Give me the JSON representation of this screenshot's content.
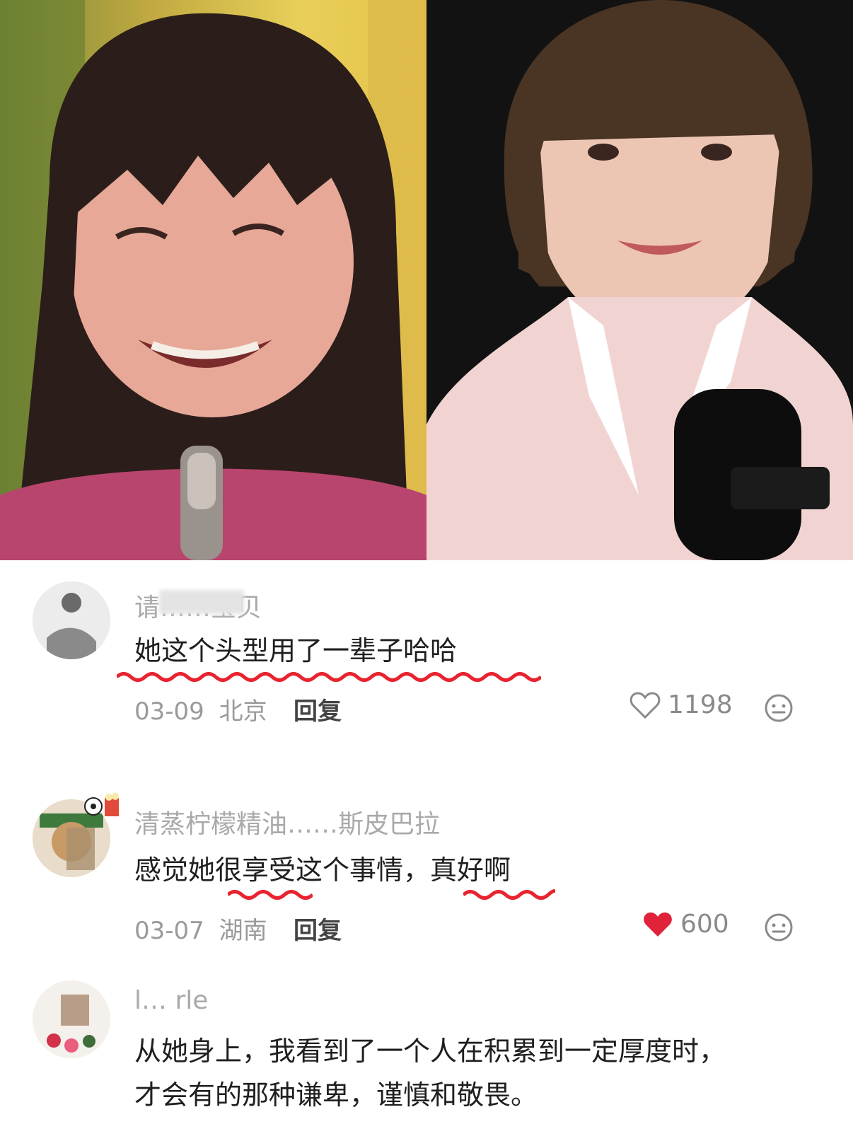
{
  "comments": [
    {
      "username": "请……宝贝",
      "text": "她这个头型用了一辈子哈哈",
      "date": "03-09",
      "location": "北京",
      "reply_label": "回复",
      "likes": "1198",
      "liked": false
    },
    {
      "username": "清蒸柠檬精油……斯皮巴拉",
      "text_parts": [
        "感觉她",
        "很享受",
        "这个事情，",
        "真好啊"
      ],
      "date": "03-07",
      "location": "湖南",
      "reply_label": "回复",
      "likes": "600",
      "liked": true
    },
    {
      "username": "l… rle",
      "text_line1": "从她身上，我看到了一个人在积累到一定厚度时，",
      "text_line2": "才会有的那种谦卑，谨慎和敬畏。"
    }
  ],
  "colors": {
    "accent_red": "#e8232f",
    "like_red": "#e0223a",
    "meta_gray": "#9a9a9a"
  },
  "icons": [
    "heart-outline-icon",
    "heart-filled-icon",
    "more-options-icon"
  ]
}
